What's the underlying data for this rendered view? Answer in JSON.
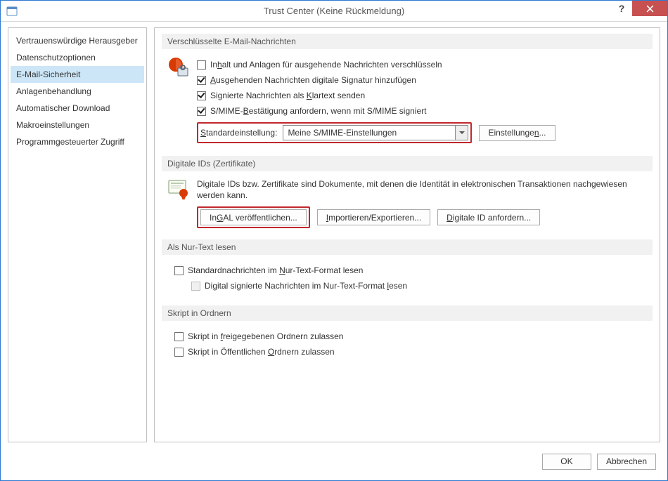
{
  "title": "Trust Center (Keine Rückmeldung)",
  "sidebar": {
    "items": [
      {
        "label": "Vertrauenswürdige Herausgeber"
      },
      {
        "label": "Datenschutzoptionen"
      },
      {
        "label": "E-Mail-Sicherheit"
      },
      {
        "label": "Anlagenbehandlung"
      },
      {
        "label": "Automatischer Download"
      },
      {
        "label": "Makroeinstellungen"
      },
      {
        "label": "Programmgesteuerter Zugriff"
      }
    ]
  },
  "sections": {
    "encrypted": {
      "header": "Verschlüsselte E-Mail-Nachrichten",
      "cb1": {
        "pre": "In",
        "u": "h",
        "post": "alt und Anlagen für ausgehende Nachrichten verschlüsseln"
      },
      "cb2": {
        "pre": "",
        "u": "A",
        "post": "usgehenden Nachrichten digitale Signatur hinzufügen"
      },
      "cb3": {
        "pre": "Signierte Nachrichten als ",
        "u": "K",
        "post": "lartext senden"
      },
      "cb4": {
        "pre": "S/MIME-",
        "u": "B",
        "post": "estätigung anfordern, wenn mit S/MIME signiert"
      },
      "std_label": {
        "u": "S",
        "post": "tandardeinstellung:"
      },
      "std_value": "Meine S/MIME-Einstellungen",
      "settings_btn": {
        "pre": "Einstellunge",
        "u": "n",
        "post": "..."
      }
    },
    "digital": {
      "header": "Digitale IDs (Zertifikate)",
      "desc": "Digitale IDs bzw. Zertifikate sind Dokumente, mit denen die Identität in elektronischen Transaktionen nachgewiesen werden kann.",
      "gal_btn": {
        "pre": "In ",
        "u": "G",
        "post": "AL veröffentlichen..."
      },
      "imp_btn": {
        "u": "I",
        "post": "mportieren/Exportieren..."
      },
      "req_btn": {
        "u": "D",
        "post": "igitale ID anfordern..."
      }
    },
    "plaintext": {
      "header": "Als Nur-Text lesen",
      "cb1": {
        "pre": "Standardnachrichten im ",
        "u": "N",
        "post": "ur-Text-Format lesen"
      },
      "cb2": {
        "pre": "Digital signierte Nachrichten im Nur-Text-Format ",
        "u": "l",
        "post": "esen"
      }
    },
    "scripts": {
      "header": "Skript in Ordnern",
      "cb1": {
        "pre": "Skript in ",
        "u": "f",
        "post": "reigegebenen Ordnern zulassen"
      },
      "cb2": {
        "pre": "Skript in Öffentlichen ",
        "u": "O",
        "post": "rdnern zulassen"
      }
    }
  },
  "footer": {
    "ok": "OK",
    "cancel": "Abbrechen"
  }
}
